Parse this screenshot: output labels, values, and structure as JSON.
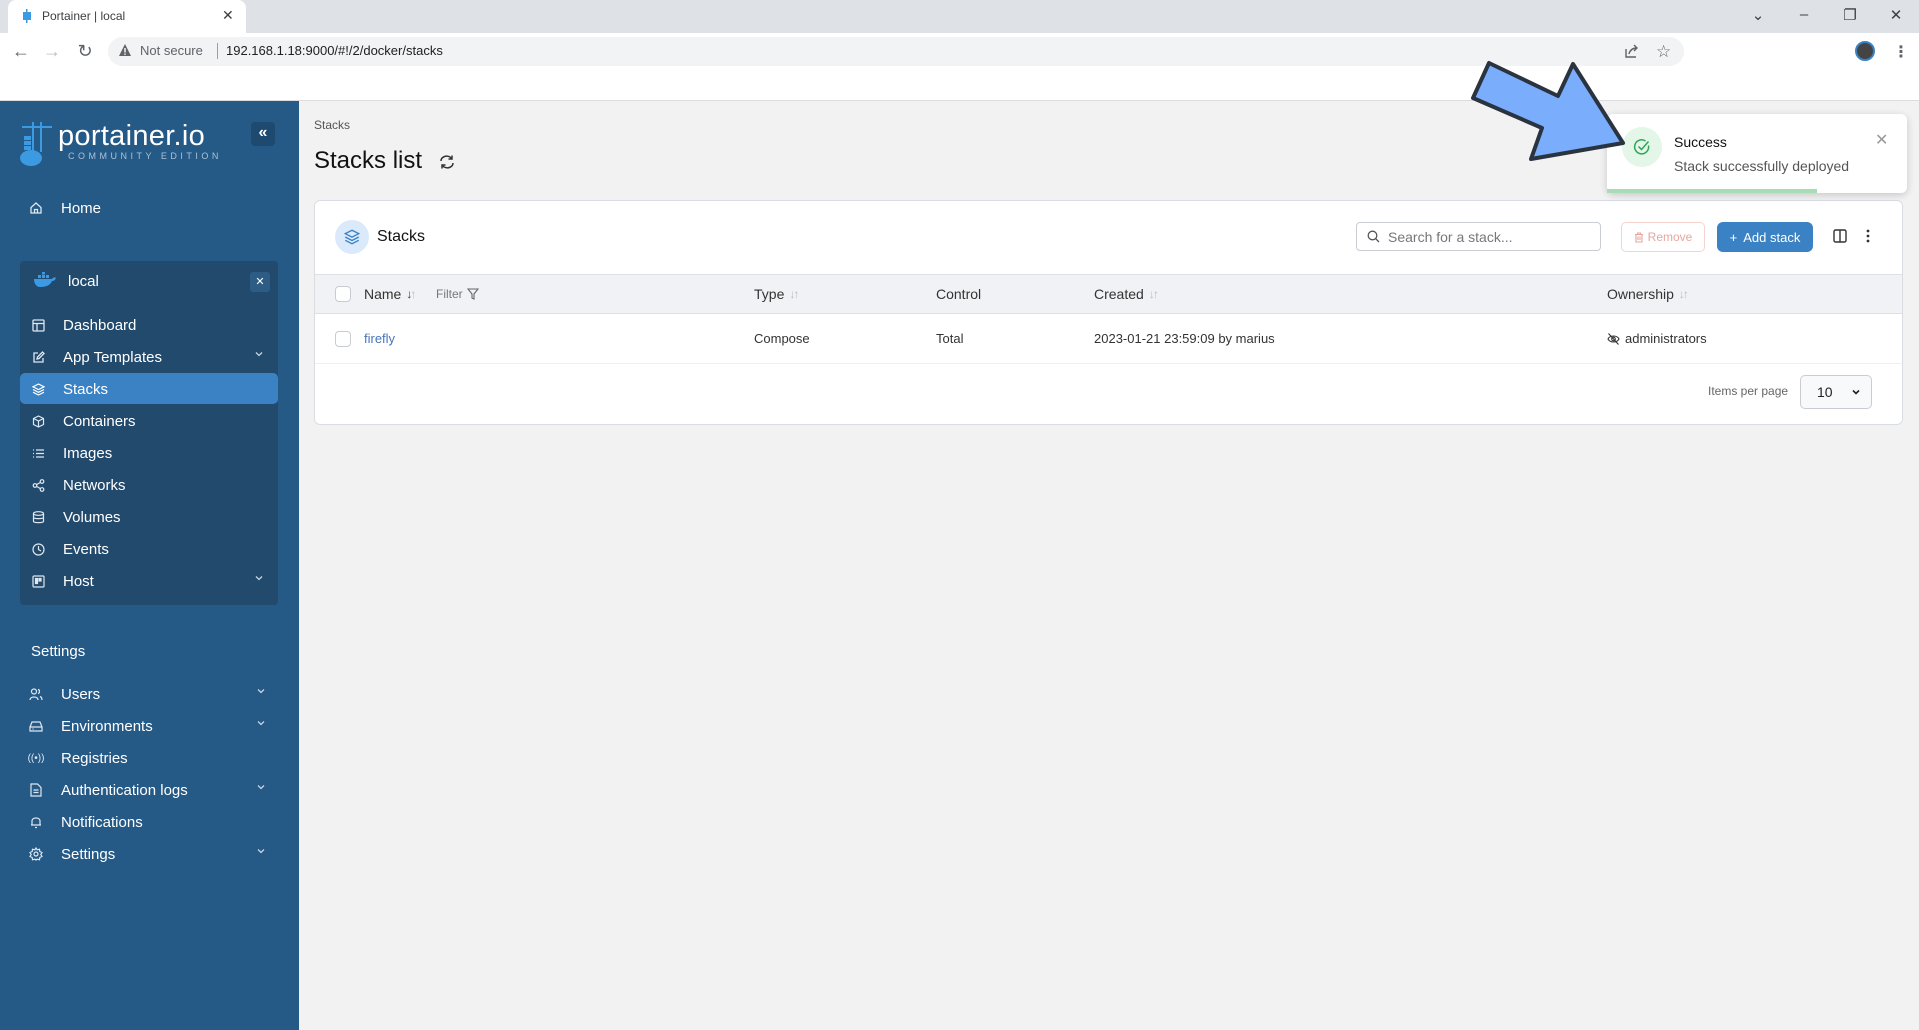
{
  "browser": {
    "tab_title": "Portainer | local",
    "security_label": "Not secure",
    "url": "192.168.1.18:9000/#!/2/docker/stacks"
  },
  "sidebar": {
    "logo_text": "portainer.io",
    "logo_subtitle": "COMMUNITY EDITION",
    "home_label": "Home",
    "environment": {
      "name": "local",
      "items": [
        {
          "label": "Dashboard",
          "icon": "dashboard-icon",
          "expandable": false
        },
        {
          "label": "App Templates",
          "icon": "edit-icon",
          "expandable": true
        },
        {
          "label": "Stacks",
          "icon": "layers-icon",
          "expandable": false,
          "active": true
        },
        {
          "label": "Containers",
          "icon": "box-icon",
          "expandable": false
        },
        {
          "label": "Images",
          "icon": "list-icon",
          "expandable": false
        },
        {
          "label": "Networks",
          "icon": "share-icon",
          "expandable": false
        },
        {
          "label": "Volumes",
          "icon": "database-icon",
          "expandable": false
        },
        {
          "label": "Events",
          "icon": "clock-icon",
          "expandable": false
        },
        {
          "label": "Host",
          "icon": "server-icon",
          "expandable": true
        }
      ]
    },
    "settings_heading": "Settings",
    "settings_items": [
      {
        "label": "Users",
        "icon": "users-icon",
        "expandable": true
      },
      {
        "label": "Environments",
        "icon": "hard-drive-icon",
        "expandable": true
      },
      {
        "label": "Registries",
        "icon": "radio-icon",
        "expandable": false
      },
      {
        "label": "Authentication logs",
        "icon": "file-text-icon",
        "expandable": true
      },
      {
        "label": "Notifications",
        "icon": "bell-icon",
        "expandable": false
      },
      {
        "label": "Settings",
        "icon": "gear-icon",
        "expandable": true
      }
    ]
  },
  "page": {
    "breadcrumb": "Stacks",
    "title": "Stacks list"
  },
  "card": {
    "title": "Stacks",
    "search_placeholder": "Search for a stack...",
    "remove_label": "Remove",
    "add_label": "Add stack",
    "filter_label": "Filter",
    "columns": [
      "Name",
      "Type",
      "Control",
      "Created",
      "Ownership"
    ],
    "rows": [
      {
        "name": "firefly",
        "type": "Compose",
        "control": "Total",
        "created": "2023-01-21 23:59:09 by marius",
        "ownership": "administrators"
      }
    ],
    "items_per_page_label": "Items per page",
    "items_per_page_value": "10"
  },
  "toast": {
    "title": "Success",
    "message": "Stack successfully deployed",
    "progress": 0.7
  },
  "colors": {
    "sidebar_bg": "#255986",
    "accent": "#3b82c4",
    "success": "#2fa55a",
    "annotation_arrow": "#7aaefc"
  }
}
